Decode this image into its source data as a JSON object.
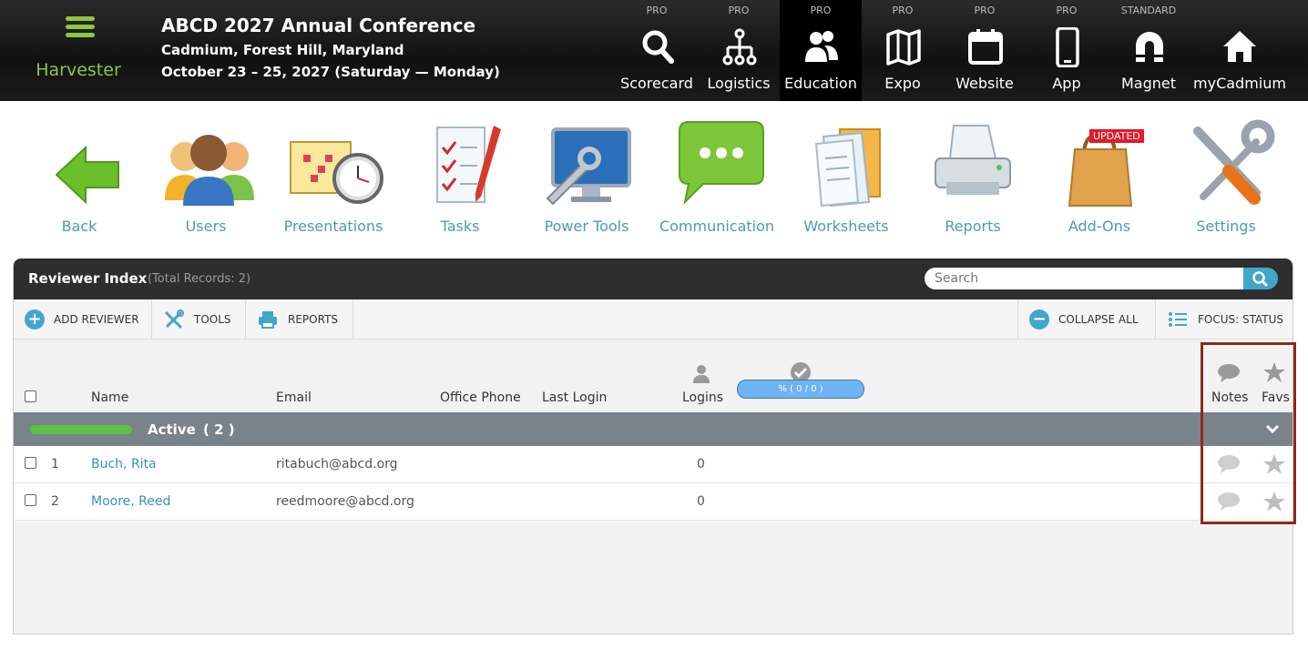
{
  "brand": {
    "name": "Harvester"
  },
  "event": {
    "title": "ABCD 2027 Annual Conference",
    "location": "Cadmium, Forest Hill, Maryland",
    "dates": "October 23 – 25, 2027 (Saturday — Monday)"
  },
  "nav": [
    {
      "tier": "PRO",
      "label": "Scorecard",
      "icon": "search-icon"
    },
    {
      "tier": "PRO",
      "label": "Logistics",
      "icon": "org-chart-icon"
    },
    {
      "tier": "PRO",
      "label": "Education",
      "icon": "people-icon",
      "active": true
    },
    {
      "tier": "PRO",
      "label": "Expo",
      "icon": "map-icon"
    },
    {
      "tier": "PRO",
      "label": "Website",
      "icon": "calendar-icon"
    },
    {
      "tier": "PRO",
      "label": "App",
      "icon": "phone-icon"
    },
    {
      "tier": "STANDARD",
      "label": "Magnet",
      "icon": "magnet-icon"
    },
    {
      "tier": "",
      "label": "myCadmium",
      "icon": "home-icon"
    }
  ],
  "tools": [
    {
      "label": "Back",
      "icon": "back-arrow-icon"
    },
    {
      "label": "Users",
      "icon": "users-icon"
    },
    {
      "label": "Presentations",
      "icon": "presentations-icon"
    },
    {
      "label": "Tasks",
      "icon": "tasks-icon"
    },
    {
      "label": "Power Tools",
      "icon": "power-tools-icon"
    },
    {
      "label": "Communication",
      "icon": "chat-icon"
    },
    {
      "label": "Worksheets",
      "icon": "worksheets-icon"
    },
    {
      "label": "Reports",
      "icon": "printer-icon"
    },
    {
      "label": "Add-Ons",
      "icon": "shopping-bag-icon",
      "badge": "UPDATED"
    },
    {
      "label": "Settings",
      "icon": "wrench-screwdriver-icon"
    }
  ],
  "panel": {
    "title": "Reviewer Index",
    "count": "(Total Records: 2)",
    "search_placeholder": "Search"
  },
  "actions": {
    "add": "ADD REVIEWER",
    "tools": "TOOLS",
    "reports": "REPORTS",
    "collapse": "COLLAPSE ALL",
    "focus": "FOCUS: STATUS"
  },
  "columns": {
    "name": "Name",
    "email": "Email",
    "phone": "Office Phone",
    "last_login": "Last Login",
    "logins": "Logins",
    "progress": "% ( 0 / 0 )",
    "notes": "Notes",
    "favs": "Favs"
  },
  "group": {
    "label": "Active",
    "count": "( 2 )"
  },
  "rows": [
    {
      "num": "1",
      "name": "Buch, Rita",
      "email": "ritabuch@abcd.org",
      "logins": "0"
    },
    {
      "num": "2",
      "name": "Moore, Reed",
      "email": "reedmoore@abcd.org",
      "logins": "0"
    }
  ],
  "colors": {
    "accent": "#42a5cc",
    "brand": "#8dc63f",
    "highlight": "#8b2a1a"
  }
}
